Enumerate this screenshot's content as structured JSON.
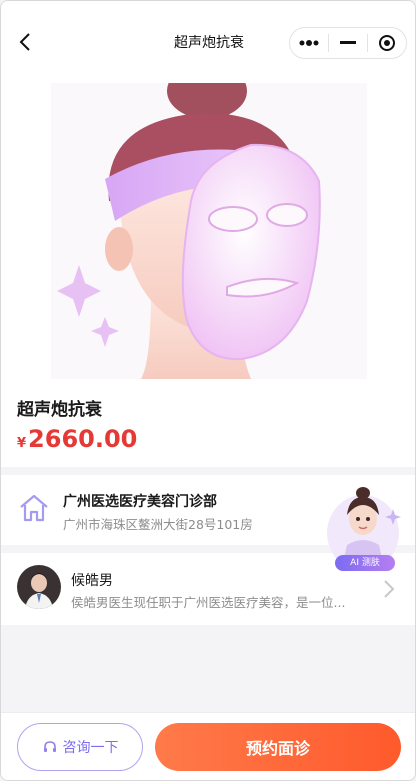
{
  "nav": {
    "title": "超声炮抗衰",
    "back_icon": "chevron-left-icon",
    "menu_icon": "more-dots-icon",
    "minimize_icon": "minus-icon",
    "close_icon": "target-close-icon"
  },
  "product": {
    "name": "超声炮抗衰",
    "currency": "¥",
    "price": "2660.00",
    "price_color": "#e53935"
  },
  "clinic": {
    "icon": "home-icon",
    "name": "广州医选医疗美容门诊部",
    "address": "广州市海珠区鳌洲大街28号101房"
  },
  "doctor": {
    "name": "候皓男",
    "description": "侯皓男医生现任职于广州医选医疗美容，是一位..."
  },
  "ai_assistant": {
    "label": "AI 测肤"
  },
  "bottom_bar": {
    "consult_label": "咨询一下",
    "consult_icon": "headset-icon",
    "book_label": "预约面诊",
    "accent": "#7b6cf2",
    "book_color": "#ff5a2c"
  }
}
